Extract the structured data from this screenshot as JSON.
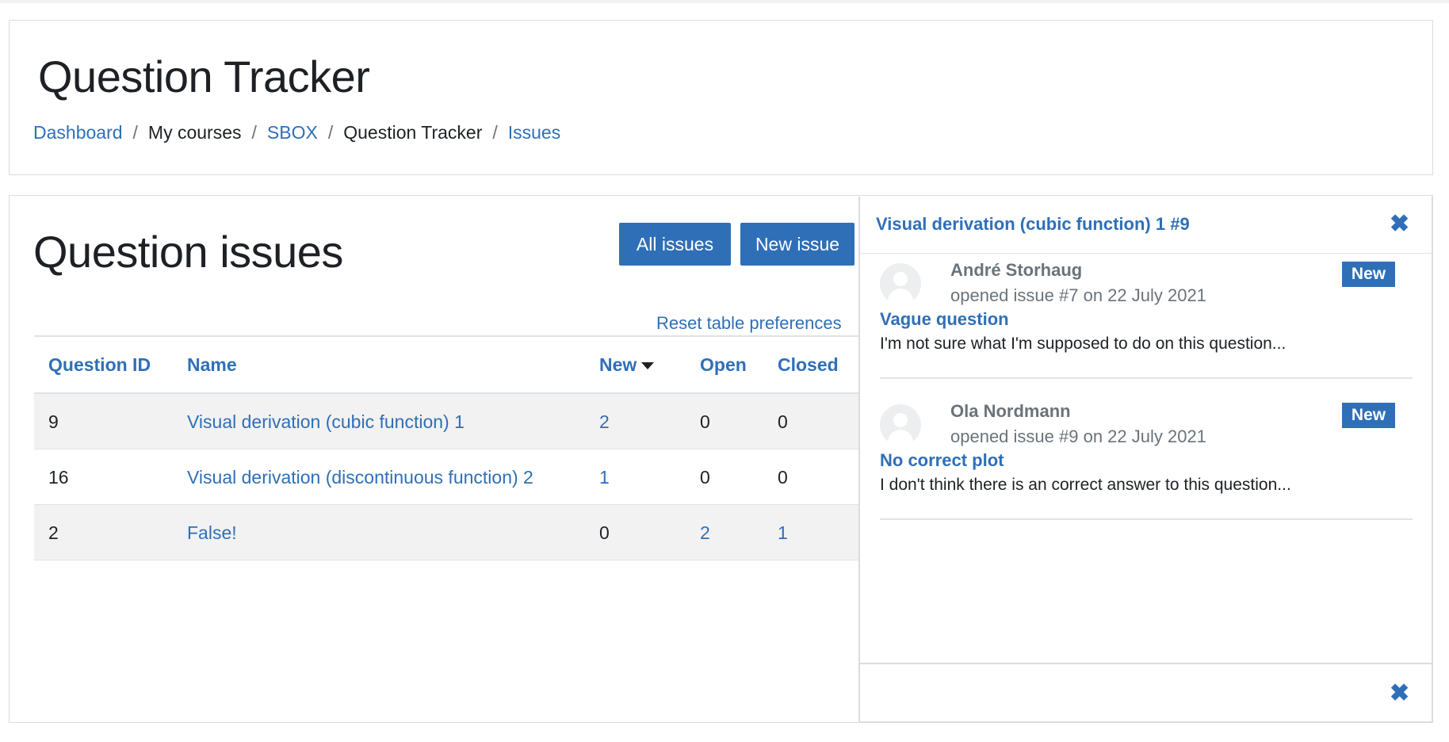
{
  "header": {
    "title": "Question Tracker",
    "breadcrumb": [
      "Dashboard",
      "My courses",
      "SBOX",
      "Question Tracker",
      "Issues"
    ],
    "separator": "/"
  },
  "main": {
    "title": "Question issues",
    "buttons": {
      "all_issues": "All issues",
      "new_issue": "New issue"
    },
    "reset_link": "Reset table preferences",
    "columns": [
      "Question ID",
      "Name",
      "New",
      "Open",
      "Closed"
    ],
    "rows": [
      {
        "id": "9",
        "name": "Visual derivation (cubic function) 1",
        "new": "2",
        "open": "0",
        "closed": "0"
      },
      {
        "id": "16",
        "name": "Visual derivation (discontinuous function) 2",
        "new": "1",
        "open": "0",
        "closed": "0"
      },
      {
        "id": "2",
        "name": "False!",
        "new": "0",
        "open": "2",
        "closed": "1"
      }
    ]
  },
  "drawer": {
    "title": "Visual derivation (cubic function) 1 #9",
    "close_icon": "close-icon",
    "issues": [
      {
        "author": "André Storhaug",
        "meta": "opened issue #7 on 22 July 2021",
        "badge": "New",
        "title": "Vague question",
        "text": "I'm not sure what I'm supposed to do on this question..."
      },
      {
        "author": "Ola Nordmann",
        "meta": "opened issue #9 on 22 July 2021",
        "badge": "New",
        "title": "No correct plot",
        "text": "I don't think there is an correct answer to this question..."
      }
    ]
  },
  "colors": {
    "accent": "#2f6fb7",
    "text": "#1d2125",
    "muted": "#6a737b",
    "row_stripe": "#f2f2f2"
  }
}
